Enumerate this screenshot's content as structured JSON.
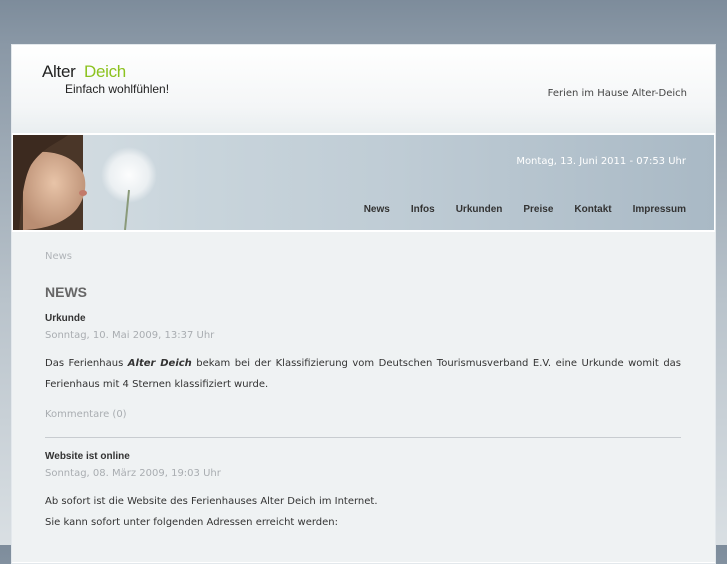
{
  "site": {
    "logo_part1": "Alter",
    "logo_part2": "Deich",
    "slogan": "Einfach wohlfühlen!",
    "subtitle": "Ferien im Hause Alter-Deich"
  },
  "banner": {
    "date": "Montag, 13. Juni 2011 - 07:53 Uhr"
  },
  "nav": [
    "News",
    "Infos",
    "Urkunden",
    "Preise",
    "Kontakt",
    "Impressum"
  ],
  "breadcrumb": "News",
  "heading": "NEWS",
  "articles": [
    {
      "title": "Urkunde",
      "date": "Sonntag, 10. Mai 2009, 13:37 Uhr",
      "body_before": "Das Ferienhaus ",
      "body_emph": "Alter Deich",
      "body_after": " bekam bei der Klassifizierung vom Deutschen Tourismusverband E.V. eine Urkunde womit das Ferienhaus mit 4 Sternen klassifiziert wurde.",
      "comments": "Kommentare (0)"
    },
    {
      "title": "Website ist online",
      "date": "Sonntag, 08. März 2009, 19:03 Uhr",
      "line1": "Ab sofort ist die Website des Ferienhauses Alter Deich im Internet.",
      "line2": "Sie kann sofort unter folgenden Adressen erreicht werden:"
    }
  ],
  "colors": {
    "accent": "#8cc21f",
    "background_top": "#7d8c9b",
    "content_bg": "#eff2f3"
  }
}
